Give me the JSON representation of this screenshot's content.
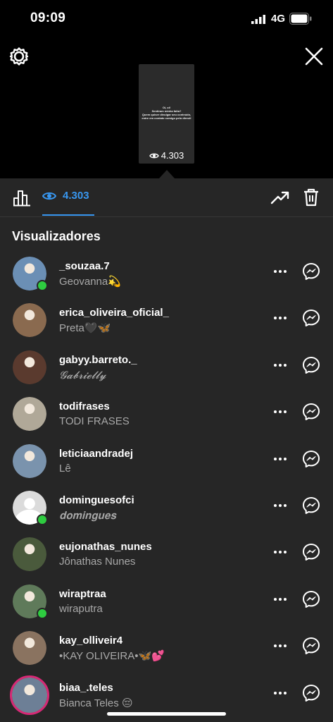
{
  "status_bar": {
    "time": "09:09",
    "network": "4G"
  },
  "story": {
    "text": "Oi, oi!\nSentiram minha falta?\nQuem quiser divulgar seu conteúdo, entre em contato comigo pelo direct!",
    "views": "4.303"
  },
  "toolbar": {
    "views_count": "4.303"
  },
  "section_title": "Visualizadores",
  "viewers": [
    {
      "username": "_souzaa.7",
      "name": "Geovanna💫",
      "online": true,
      "avatar_color": "#6b8fb5",
      "italic": false
    },
    {
      "username": "erica_oliveira_oficial_",
      "name": "Preta🖤🦋",
      "online": false,
      "avatar_color": "#8a6a4f",
      "italic": false
    },
    {
      "username": "gabyy.barreto._",
      "name": "𝓖𝓪𝓫𝓻𝓲𝓮𝓵𝓵𝔂",
      "online": false,
      "avatar_color": "#5a3a2e",
      "italic": true
    },
    {
      "username": "todifrases",
      "name": "TODI FRASES",
      "online": false,
      "avatar_color": "#b0a898",
      "italic": false
    },
    {
      "username": "leticiaandradej",
      "name": "Lê",
      "online": false,
      "avatar_color": "#7a93ad",
      "italic": false
    },
    {
      "username": "dominguesofci",
      "name": "𝐝𝐨𝐦𝐢𝐧𝐠𝐮𝐞𝐬 ",
      "online": true,
      "avatar_color": "#dbdbdb",
      "italic": true
    },
    {
      "username": "eujonathas_nunes",
      "name": "Jônathas Nunes",
      "online": false,
      "avatar_color": "#4a5a3c",
      "italic": false
    },
    {
      "username": "wiraptraa",
      "name": "wiraputra",
      "online": true,
      "avatar_color": "#5f7a5a",
      "italic": false
    },
    {
      "username": "kay_olliveir4",
      "name": "•KAY OLIVEIRA•🦋💕",
      "online": false,
      "avatar_color": "#8a7360",
      "italic": false
    },
    {
      "username": "biaa_.teles",
      "name": "Bianca Teles 😔",
      "online": false,
      "avatar_color": "#6d7f96",
      "italic": false,
      "story_ring": true
    }
  ]
}
